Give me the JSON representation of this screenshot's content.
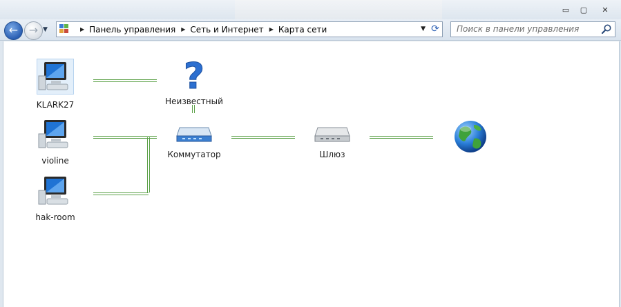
{
  "window": {
    "controls": {
      "minimize": "▭",
      "maximize": "▢",
      "close": "✕"
    }
  },
  "navigation": {
    "back_icon": "←",
    "forward_icon": "→",
    "history_icon": "▼",
    "breadcrumbs": [
      "Панель управления",
      "Сеть и Интернет",
      "Карта сети"
    ],
    "dropdown_icon": "▼",
    "refresh_icon": "⟳"
  },
  "search": {
    "placeholder": "Поиск в панели управления",
    "icon": "search-icon"
  },
  "network_map": {
    "computers": [
      {
        "name": "KLARK27"
      },
      {
        "name": "violine"
      },
      {
        "name": "hak-room"
      }
    ],
    "unknown": {
      "label": "Неизвестный"
    },
    "switch": {
      "label": "Коммутатор"
    },
    "gateway": {
      "label": "Шлюз"
    },
    "internet": {
      "icon": "globe-icon"
    }
  },
  "colors": {
    "link_line": "#5aa046",
    "accent": "#2b5fb3"
  }
}
